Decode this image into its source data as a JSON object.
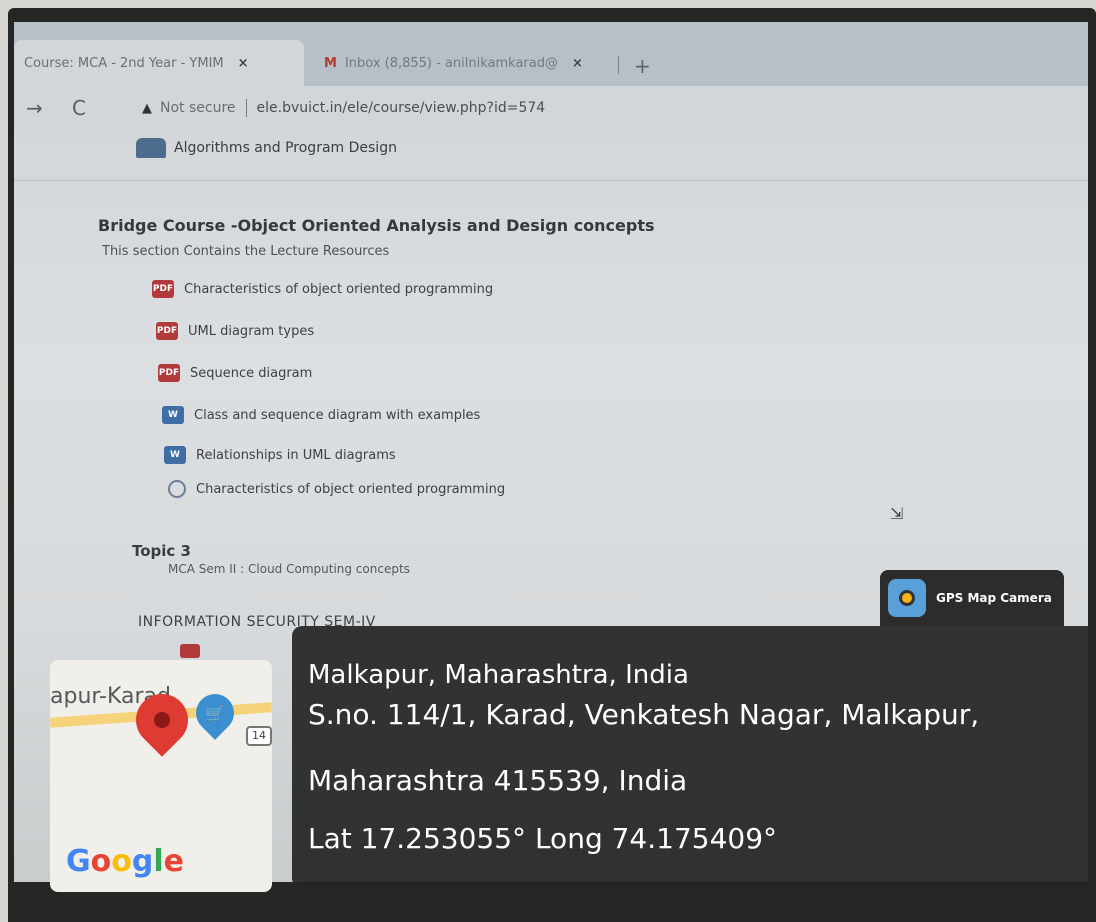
{
  "browser": {
    "tabs": [
      {
        "label": "Course: MCA - 2nd Year - YMIM",
        "close": "×",
        "active": true
      },
      {
        "label": "Inbox (8,855) - anilnikamkarad@",
        "close": "×",
        "active": false,
        "icon": "gmail-icon"
      }
    ],
    "new_tab": "+",
    "back": "→",
    "reload": "C",
    "security_label": "Not secure",
    "url": "ele.bvuict.in/ele/course/view.php?id=574"
  },
  "course": {
    "top_link": "Algorithms and Program Design",
    "section_title": "Bridge Course -Object Oriented Analysis and Design concepts",
    "section_subtitle": "This section Contains the Lecture Resources",
    "resources": [
      {
        "label": "Characteristics of object oriented programming",
        "icon": "pdf-icon"
      },
      {
        "label": "UML diagram types",
        "icon": "pdf-icon"
      },
      {
        "label": "Sequence diagram",
        "icon": "pdf-icon"
      },
      {
        "label": "Class and sequence diagram with examples",
        "icon": "word-icon"
      },
      {
        "label": "Relationships in UML diagrams",
        "icon": "word-icon"
      },
      {
        "label": "Characteristics of object oriented programming",
        "icon": "quiz-icon"
      }
    ],
    "topic_title": "Topic 3",
    "topic_subtitle": "MCA Sem II : Cloud Computing concepts",
    "info_section": "INFORMATION SECURITY SEM-IV"
  },
  "gps": {
    "app_name": "GPS Map Camera",
    "city": "Malkapur, Maharashtra, India",
    "address_line1": "S.no. 114/1, Karad, Venkatesh Nagar, Malkapur,",
    "address_line2": "Maharashtra 415539, India",
    "coordinates": "Lat 17.253055° Long 74.175409°",
    "map_town": "apur-Karad",
    "map_route": "14",
    "map_brand": "Google"
  },
  "colors": {
    "pdf": "#b23a3a",
    "word": "#3f6ea7",
    "overlay": "#242424",
    "pin": "#de3b33"
  }
}
